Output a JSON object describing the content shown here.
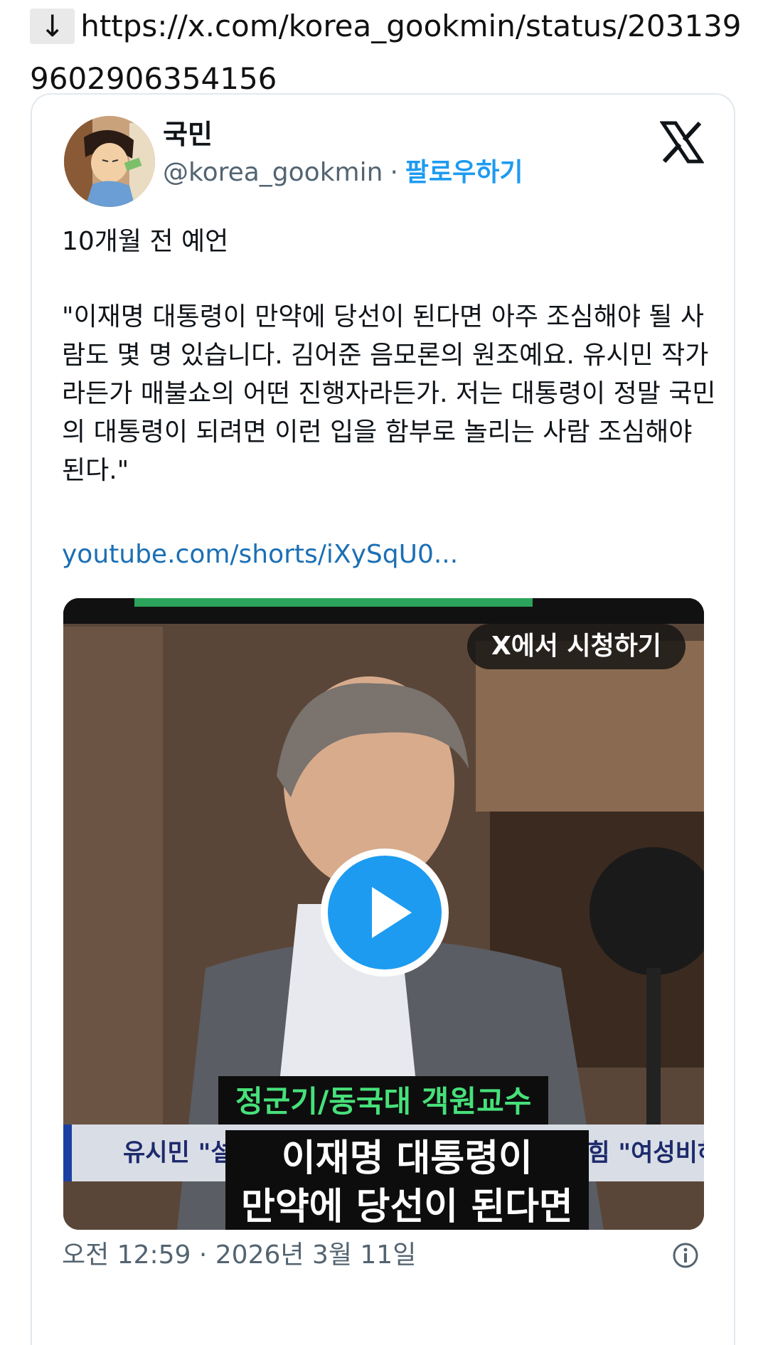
{
  "url_bar": {
    "arrow": "↓",
    "url": "https://x.com/korea_gookmin/status/2031399602906354156"
  },
  "tweet": {
    "display_name": "국민",
    "handle": "@korea_gookmin",
    "separator": "·",
    "follow_label": "팔로우하기",
    "text_line1": "10개월 전 예언",
    "text_quote": "\"이재명 대통령이 만약에 당선이 된다면 아주 조심해야 될 사람도 몇 명 있습니다. 김어준 음모론의 원조예요. 유시민 작가라든가 매불쇼의 어떤 진행자라든가. 저는 대통령이 정말 국민의 대통령이 되려면 이런 입을 함부로 놀리는 사람 조심해야 된다.\"",
    "link_text": "youtube.com/shorts/iXySqU0...",
    "timestamp": "오전 12:59 · 2026년 3월 11일"
  },
  "media": {
    "watch_button": "X에서 시청하기",
    "caption_name": "정군기/동국대 객원교수",
    "ticker_left": "유시민 \"설",
    "ticker_right": "국힘 \"여성비하 · 트",
    "subtitle_line1": "이재명 대통령이",
    "subtitle_line2": "만약에 당선이 된다면"
  },
  "colors": {
    "accent": "#1d9bf0",
    "link": "#1b6fb4",
    "caption_green": "#47e07a"
  },
  "icons": [
    "down-arrow-icon",
    "x-logo-icon",
    "play-icon",
    "info-icon"
  ]
}
